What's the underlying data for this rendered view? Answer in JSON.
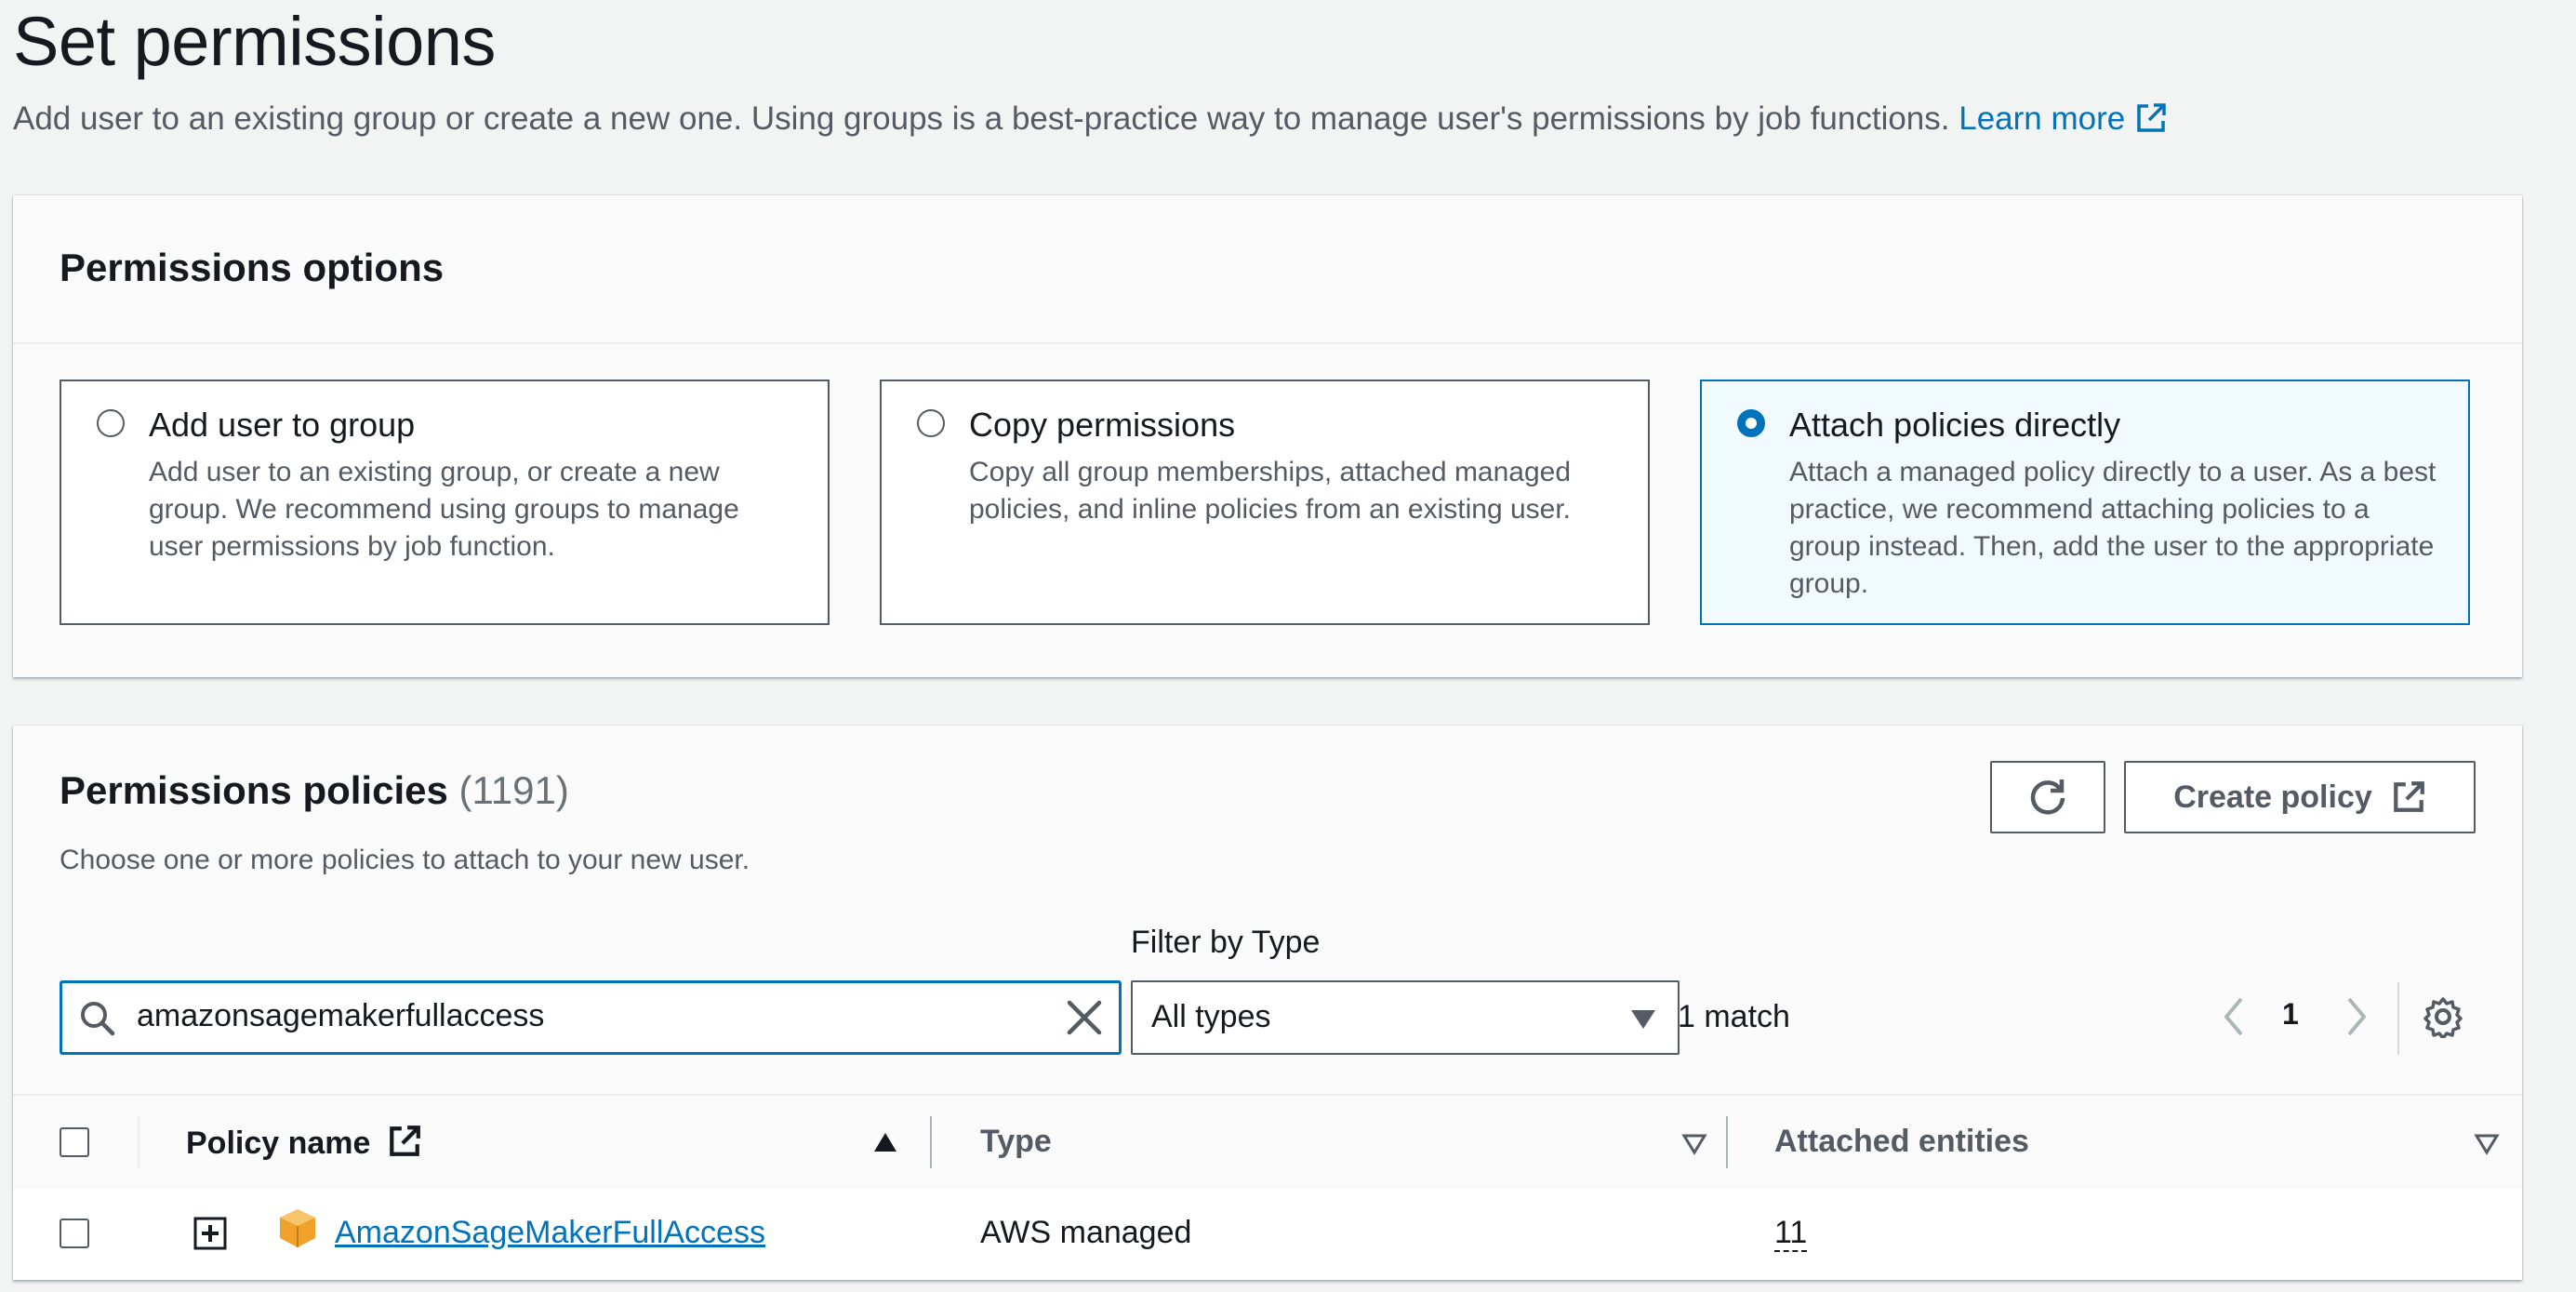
{
  "page": {
    "title": "Set permissions",
    "description": "Add user to an existing group or create a new one. Using groups is a best-practice way to manage user's permissions by job functions.",
    "learn_more": "Learn more"
  },
  "options": {
    "title": "Permissions options",
    "tiles": [
      {
        "title": "Add user to group",
        "desc": "Add user to an existing group, or create a new group. We recommend using groups to manage user permissions by job function.",
        "selected": false
      },
      {
        "title": "Copy permissions",
        "desc": "Copy all group memberships, attached managed policies, and inline policies from an existing user.",
        "selected": false
      },
      {
        "title": "Attach policies directly",
        "desc": "Attach a managed policy directly to a user. As a best practice, we recommend attaching policies to a group instead. Then, add the user to the appropriate group.",
        "selected": true
      }
    ]
  },
  "policies": {
    "title": "Permissions policies",
    "count": "(1191)",
    "description": "Choose one or more policies to attach to your new user.",
    "create_policy_label": "Create policy",
    "filter_label": "Filter by Type",
    "search_value": "amazonsagemakerfullaccess",
    "type_select": "All types",
    "match_text": "1 match",
    "page_number": "1",
    "columns": {
      "policy_name": "Policy name",
      "type": "Type",
      "attached_entities": "Attached entities"
    },
    "rows": [
      {
        "policy_name": "AmazonSageMakerFullAccess",
        "type": "AWS managed",
        "attached_entities": "11"
      }
    ]
  },
  "colors": {
    "accent": "#0073bb",
    "text": "#16191f",
    "muted": "#545b64",
    "policy_icon": "#f0a12b"
  }
}
